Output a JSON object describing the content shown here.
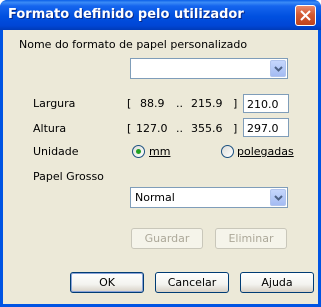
{
  "window": {
    "title": "Formato definido pelo utilizador"
  },
  "paper_name": {
    "label": "Nome do formato de papel personalizado",
    "value": ""
  },
  "width": {
    "label": "Largura",
    "range_open": "[",
    "min": "88.9",
    "sep": "..",
    "max": "215.9",
    "range_close": "]",
    "value": "210.0"
  },
  "height": {
    "label": "Altura",
    "range_open": "[",
    "min": "127.0",
    "sep": "..",
    "max": "355.6",
    "range_close": "]",
    "value": "297.0"
  },
  "unit": {
    "label": "Unidade",
    "options": [
      "mm",
      "polegadas"
    ],
    "selected": "mm"
  },
  "thick_paper": {
    "label": "Papel Grosso",
    "value": "Normal"
  },
  "buttons": {
    "save": "Guardar",
    "delete": "Eliminar",
    "ok": "OK",
    "cancel": "Cancelar",
    "help": "Ajuda"
  }
}
